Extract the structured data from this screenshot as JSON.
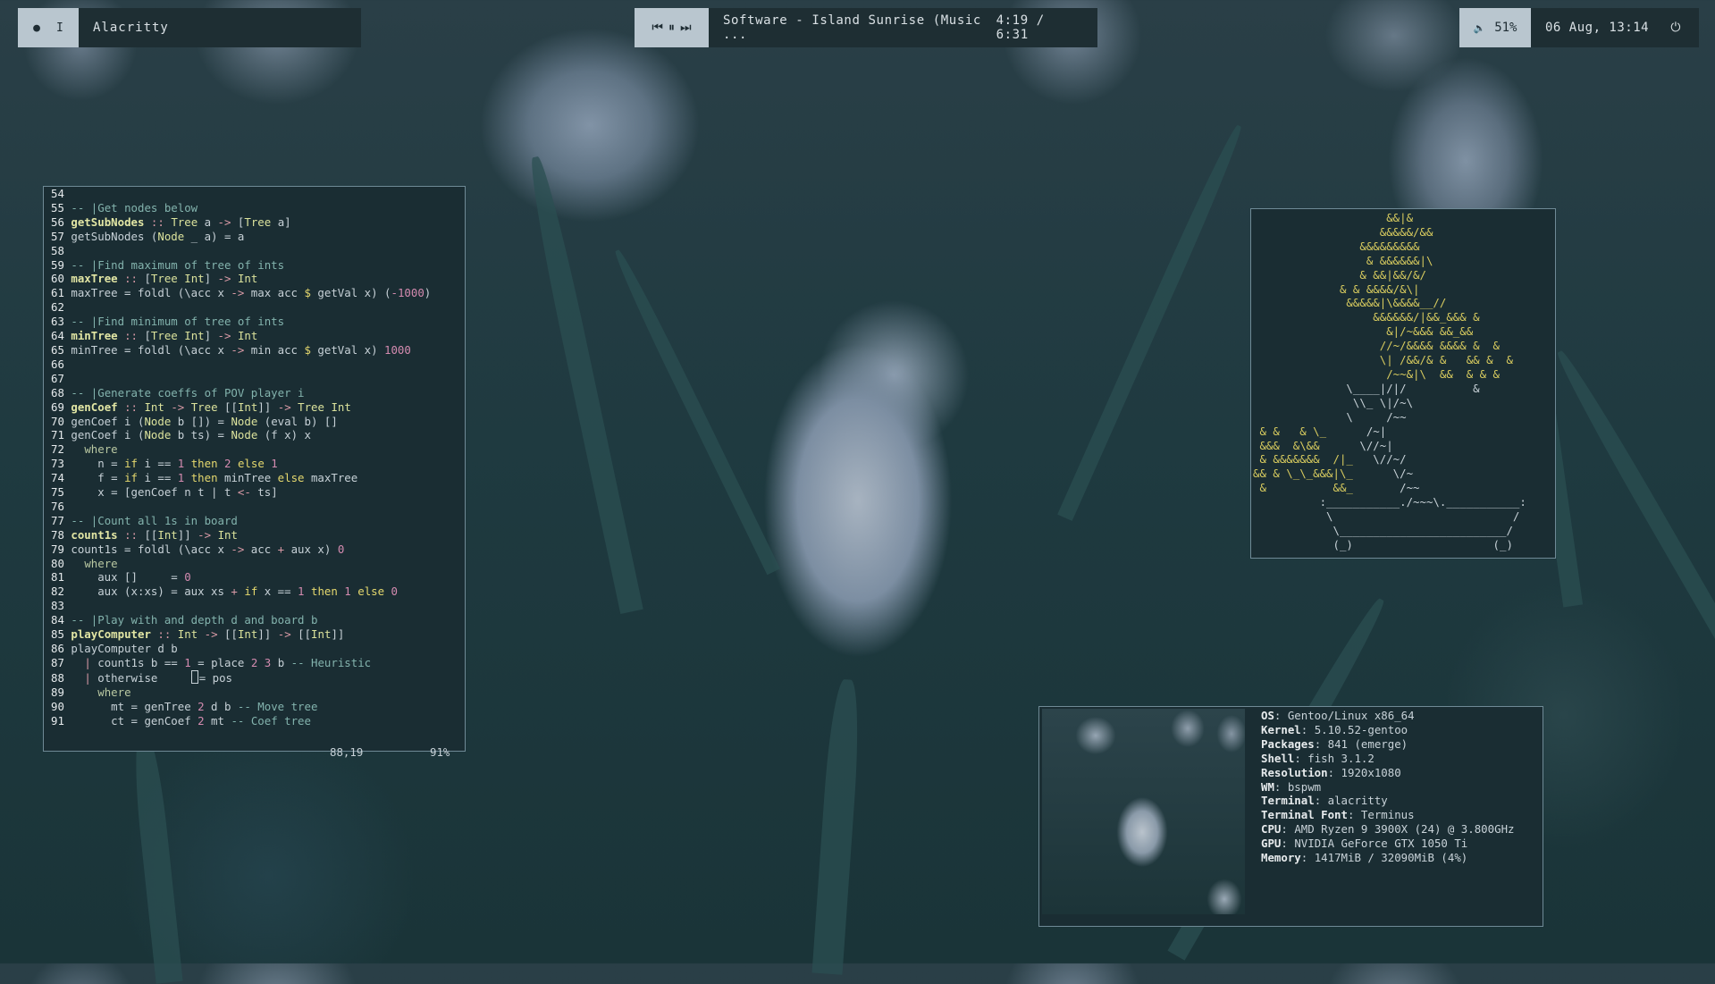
{
  "topbar": {
    "left": {
      "workspace_dot": "●",
      "workspace_label": "I",
      "window_title": "Alacritty"
    },
    "media": {
      "prev_icon": "⏮",
      "pause_icon": "⏸",
      "next_icon": "⏭",
      "track": "Software - Island Sunrise (Music ...",
      "time": "4:19 / 6:31"
    },
    "right": {
      "volume_icon": "🔈",
      "volume": "51%",
      "datetime": "06 Aug, 13:14",
      "power_icon": "⏻"
    }
  },
  "vim": {
    "status_pos": "88,19",
    "status_pct": "91%"
  },
  "fetch": {
    "rows": [
      {
        "key": "OS",
        "value": "Gentoo/Linux x86_64"
      },
      {
        "key": "Kernel",
        "value": "5.10.52-gentoo"
      },
      {
        "key": "Packages",
        "value": "841 (emerge)"
      },
      {
        "key": "Shell",
        "value": "fish 3.1.2"
      },
      {
        "key": "Resolution",
        "value": "1920x1080"
      },
      {
        "key": "WM",
        "value": "bspwm"
      },
      {
        "key": "Terminal",
        "value": "alacritty"
      },
      {
        "key": "Terminal Font",
        "value": "Terminus"
      },
      {
        "key": "CPU",
        "value": "AMD Ryzen 9 3900X (24) @ 3.800GHz"
      },
      {
        "key": "GPU",
        "value": "NVIDIA GeForce GTX 1050 Ti"
      },
      {
        "key": "Memory",
        "value": "1417MiB / 32090MiB (4%)"
      }
    ]
  },
  "colors": {
    "bar_light": "#b9c6cf",
    "bar_dark": "#1e2e33",
    "terminal_bg": "#1a2d33",
    "ascii_yellow": "#d9cc5f"
  }
}
